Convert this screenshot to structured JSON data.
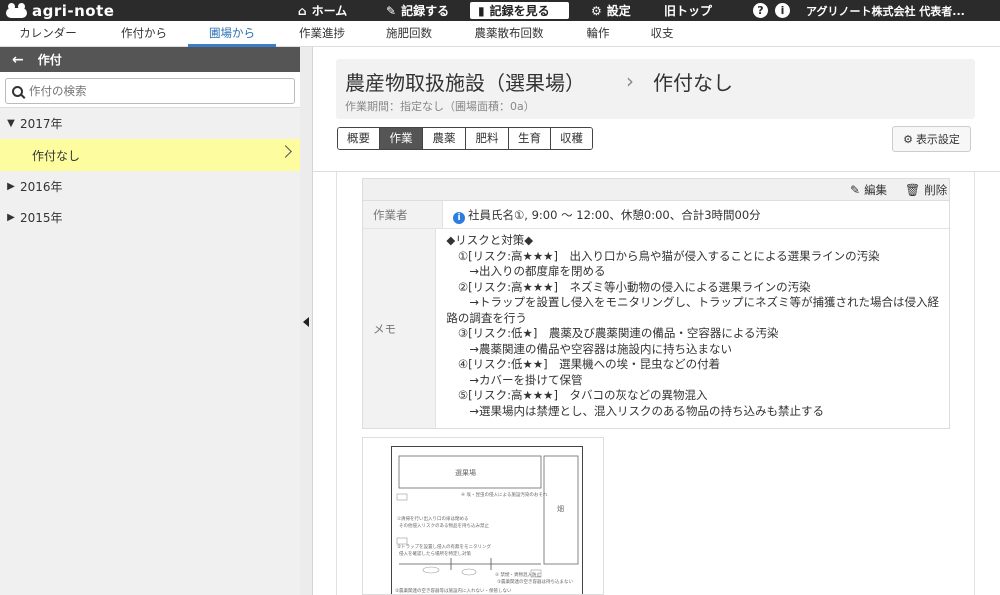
{
  "app": {
    "logo_text": "agri-note"
  },
  "topnav": {
    "home": "ホーム",
    "record": "記録する",
    "view_records": "記録を見る",
    "settings": "設定",
    "old_top": "旧トップ",
    "company": "アグリノート株式会社 代表者..."
  },
  "tabs": [
    "カレンダー",
    "作付から",
    "圃場から",
    "作業進捗",
    "施肥回数",
    "農薬散布回数",
    "輪作",
    "収支"
  ],
  "sidebar": {
    "title": "作付",
    "search_placeholder": "作付の検索",
    "years": [
      "2017年",
      "2016年",
      "2015年"
    ],
    "selected_item": "作付なし"
  },
  "main": {
    "field_name": "農産物取扱施設（選果場）",
    "crop": "作付なし",
    "period": "作業期間：指定なし（圃場面積：0a）",
    "category_tabs": [
      "概要",
      "作業",
      "農薬",
      "肥料",
      "生育",
      "収穫"
    ],
    "display_settings": "表示設定"
  },
  "record": {
    "edit": "編集",
    "delete": "削除",
    "worker_label": "作業者",
    "worker_value": "社員氏名①, 9:00 〜 12:00、休憩0:00、合計3時間00分",
    "memo_label": "メモ",
    "memo_lines": [
      "◆リスクと対策◆",
      "　①[リスク:高★★★]　出入り口から鳥や猫が侵入することによる選果ラインの汚染",
      "　　→出入りの都度扉を閉める",
      "　②[リスク:高★★★]　ネズミ等小動物の侵入による選果ラインの汚染",
      "　　→トラップを設置し侵入をモニタリングし、トラップにネズミ等が捕獲された場合は侵入経",
      "路の調査を行う",
      "　③[リスク:低★]　農薬及び農薬関連の備品・空容器による汚染",
      "　　→農薬関連の備品や空容器は施設内に持ち込まない",
      "　④[リスク:低★★]　選果機への埃・昆虫などの付着",
      "　　→カバーを掛けて保管",
      "　⑤[リスク:高★★★]　タバコの灰などの異物混入",
      "　　→選果場内は禁煙とし、混入リスクのある物品の持ち込みも禁止する"
    ]
  },
  "attachment": {
    "box1": "選果場",
    "box2": "畑",
    "note1": "④ 埃・昆虫の侵入による施設汚染のおそれ",
    "note2": "①清掃を行い出入り口の扉は閉める",
    "note3": "その他侵入リスクのある物品を持ち込み禁止",
    "note4": "②トラップを設置し侵入の有無をモニタリング",
    "note5": "侵入を確認したら場所を特定し対策",
    "note6": "⑤ 禁煙・異物混入防止",
    "note7": "③農薬関連の空き容器は持ち込まない",
    "note8": "②農薬関連の空き容器等は施設内に入れない・保管しない"
  },
  "colors": {
    "topbar": "#2b2b2b",
    "accent": "#3b7ec6",
    "selected": "#fdfda0",
    "info": "#2b7de0"
  }
}
